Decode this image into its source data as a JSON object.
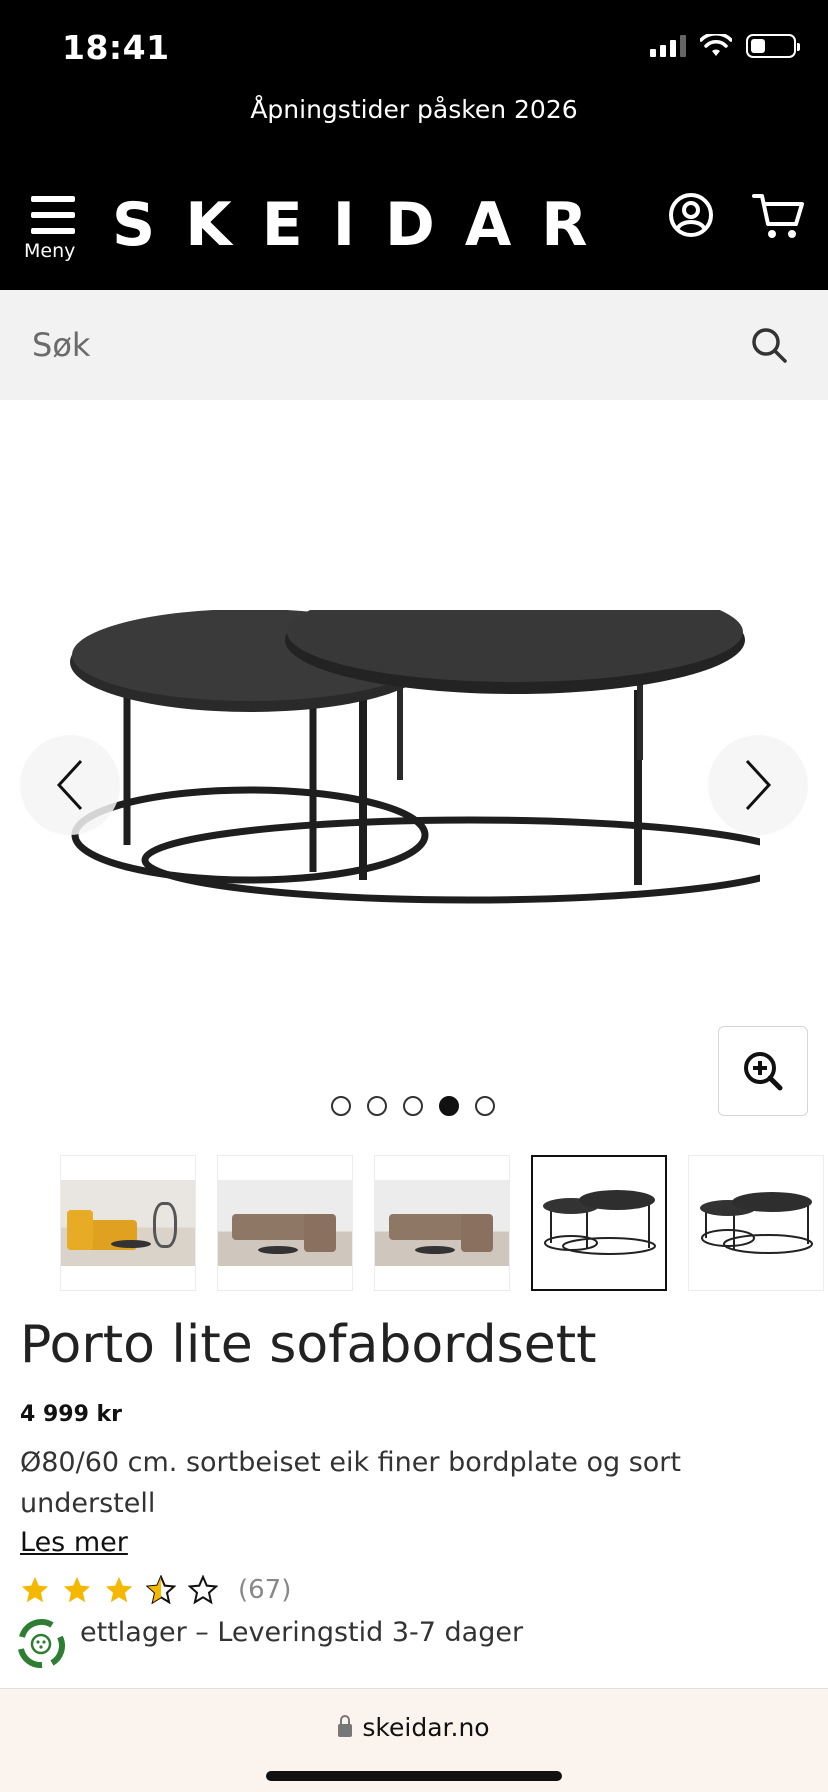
{
  "status_bar": {
    "time": "18:41"
  },
  "announcement": "Åpningstider påsken 2026",
  "header": {
    "menu_label": "Meny",
    "logo": "SKEIDAR"
  },
  "search": {
    "placeholder": "Søk"
  },
  "gallery": {
    "image_count": 5,
    "active_index": 4
  },
  "product": {
    "title": "Porto lite sofabordsett",
    "price": "4 999 kr",
    "description": "Ø80/60 cm. sortbeiset eik finer bordplate og sort understell",
    "read_more": "Les mer",
    "rating": 3.5,
    "rating_max": 5,
    "review_count": "(67)",
    "availability": "ettlager – Leveringstid 3-7 dager"
  },
  "browser": {
    "url": "skeidar.no"
  },
  "colors": {
    "star": "#f5b800",
    "header_bg": "#000000",
    "search_bg": "#f2f2f2"
  }
}
